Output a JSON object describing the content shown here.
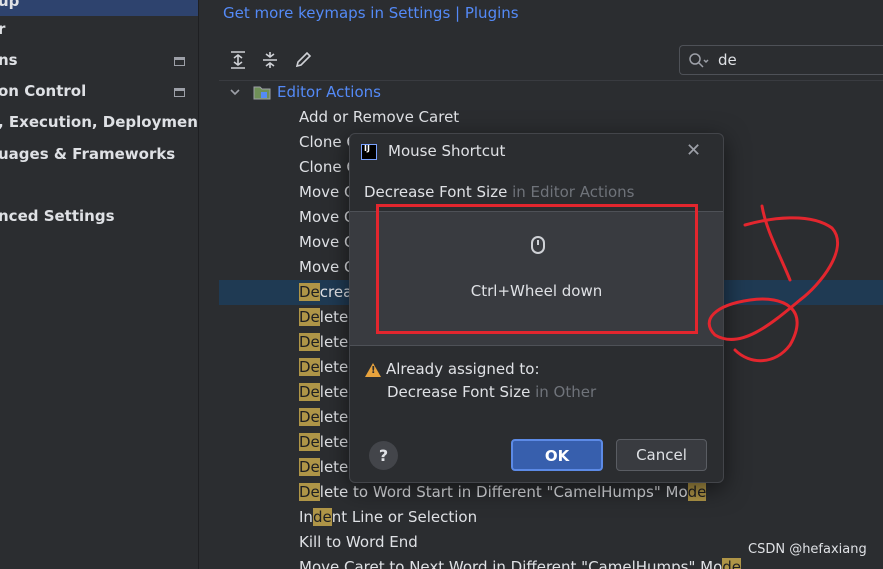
{
  "left_nav": {
    "items": [
      {
        "label": "up",
        "pinned": false
      },
      {
        "label": "r",
        "pinned": false
      },
      {
        "label": "ns",
        "pinned": true
      },
      {
        "label": "on Control",
        "pinned": true
      },
      {
        "label": ", Execution, Deployment",
        "pinned": false
      },
      {
        "label": "uages & Frameworks",
        "pinned": false
      },
      {
        "label": "nced Settings",
        "pinned": false
      }
    ]
  },
  "header": {
    "keymap_link": "Get more keymaps in Settings | Plugins"
  },
  "toolbar": {
    "icons": [
      "expand-all-icon",
      "collapse-all-icon",
      "edit-icon"
    ]
  },
  "search": {
    "value": "de",
    "icon": "search-icon"
  },
  "tree": {
    "group_label": "Editor Actions",
    "rows": [
      {
        "pre": "",
        "hl": "",
        "post": "Add or Remove Caret"
      },
      {
        "pre": "",
        "hl": "",
        "post": "Clone C"
      },
      {
        "pre": "",
        "hl": "",
        "post": "Clone C"
      },
      {
        "pre": "",
        "hl": "",
        "post": "Move C"
      },
      {
        "pre": "",
        "hl": "",
        "post": "Move C"
      },
      {
        "pre": "",
        "hl": "",
        "post": "Move C"
      },
      {
        "pre": "",
        "hl": "",
        "post": "Move C"
      },
      {
        "pre": "",
        "hl": "De",
        "post": "crea"
      },
      {
        "pre": "",
        "hl": "De",
        "post": "lete"
      },
      {
        "pre": "",
        "hl": "De",
        "post": "lete"
      },
      {
        "pre": "",
        "hl": "De",
        "post": "lete"
      },
      {
        "pre": "",
        "hl": "De",
        "post": "lete"
      },
      {
        "pre": "",
        "hl": "De",
        "post": "lete"
      },
      {
        "pre": "",
        "hl": "De",
        "post": "lete"
      },
      {
        "pre": "",
        "hl": "De",
        "post": "lete"
      },
      {
        "pre": "",
        "hl": "De",
        "post": "lete to Word Start in Different \"CamelHumps\" Mo",
        "hl2": "de"
      },
      {
        "pre": "In",
        "hl": "de",
        "post": "nt Line or Selection"
      },
      {
        "pre": "",
        "hl": "",
        "post": "Kill to Word End"
      },
      {
        "pre": "",
        "hl": "",
        "post": "Move Caret to Next Word in Different \"CamelHumps\" Mo",
        "hl2": "de"
      }
    ]
  },
  "dialog": {
    "title": "Mouse Shortcut",
    "action_name": "Decrease Font Size",
    "action_context": " in Editor Actions",
    "shortcut": "Ctrl+Wheel down",
    "warning": "Already assigned to:",
    "conflict_name": "Decrease Font Size",
    "conflict_context": " in Other",
    "help_label": "?",
    "ok_label": "OK",
    "cancel_label": "Cancel"
  },
  "watermark": "CSDN @hefaxiang",
  "colors": {
    "accent": "#548af7",
    "highlight": "#af9547",
    "annotation_red": "#e3262e"
  }
}
